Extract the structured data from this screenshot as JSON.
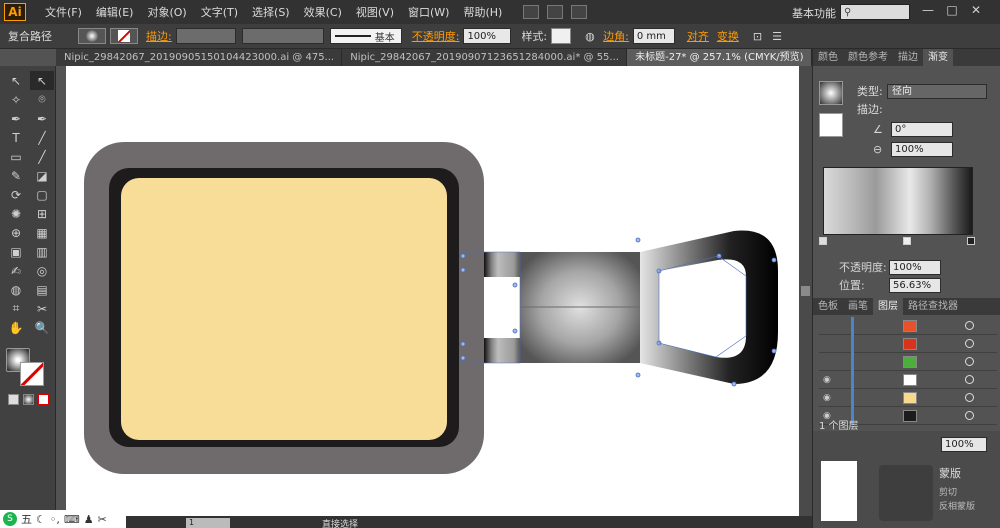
{
  "app": {
    "logo": "Ai"
  },
  "menu": [
    "文件(F)",
    "编辑(E)",
    "对象(O)",
    "文字(T)",
    "选择(S)",
    "效果(C)",
    "视图(V)",
    "窗口(W)",
    "帮助(H)"
  ],
  "workspace": "基本功能",
  "window_controls": [
    "—",
    "□",
    "✕"
  ],
  "control_bar": {
    "selection": "复合路径",
    "stroke_label": "描边:",
    "brush_label": "基本",
    "opacity_label": "不透明度:",
    "opacity_value": "100%",
    "style_label": "样式:",
    "corner_label": "边角:",
    "corner_value": "0 mm",
    "align_label": "对齐",
    "transform_label": "变换"
  },
  "tabs": [
    "Nipic_29842067_20190905150104423000.ai @ 475...",
    "Nipic_29842067_20190907123651284000.ai* @ 55...",
    "未标题-27* @ 257.1% (CMYK/预览)"
  ],
  "tools": [
    "↖",
    "↖",
    "✧",
    "⌾",
    "✒",
    "✒",
    "T",
    "╱",
    "▭",
    "╱",
    "✎",
    "◪",
    "⟳",
    "▢",
    "✺",
    "⊞",
    "⊕",
    "▦",
    "▣",
    "▥",
    "✍",
    "◎",
    "◍",
    "▤",
    "⌗",
    "✂",
    "✋",
    "🔍"
  ],
  "gradient_panel": {
    "tabs": [
      "颜色",
      "颜色参考",
      "描边",
      "渐变"
    ],
    "type_label": "类型:",
    "type_value": "径向",
    "stroke_label": "描边:",
    "angle_value": "0°",
    "aspect_value": "100%",
    "opacity_label": "不透明度:",
    "opacity_value": "100%",
    "location_label": "位置:",
    "location_value": "56.63%"
  },
  "layers_panel": {
    "tabs": [
      "色板",
      "画笔",
      "图层",
      "路径查找器"
    ],
    "rows": [
      {
        "eye": "",
        "thumb_color": "#e8522a"
      },
      {
        "eye": "",
        "thumb_color": "#d9331c"
      },
      {
        "eye": "",
        "thumb_color": "#4caf3c"
      },
      {
        "eye": "◉",
        "thumb_color": "#ffffff"
      },
      {
        "eye": "◉",
        "thumb_color": "#f7d990"
      },
      {
        "eye": "◉",
        "thumb_color": "#1b1b1b"
      }
    ],
    "footer": "1 个图层"
  },
  "bottom_panel": {
    "zoom": "100%",
    "items": [
      "蒙版",
      "剪切",
      "反相蒙版"
    ]
  },
  "status_bar": {
    "ime_label": "五",
    "zoom": "1",
    "mode": "直接选择"
  },
  "colors": {
    "outer_frame": "#6f6a6b",
    "inner_frame": "#1d1b1b",
    "panel_fill": "#f7dd97",
    "accent": "#ff9a00"
  }
}
